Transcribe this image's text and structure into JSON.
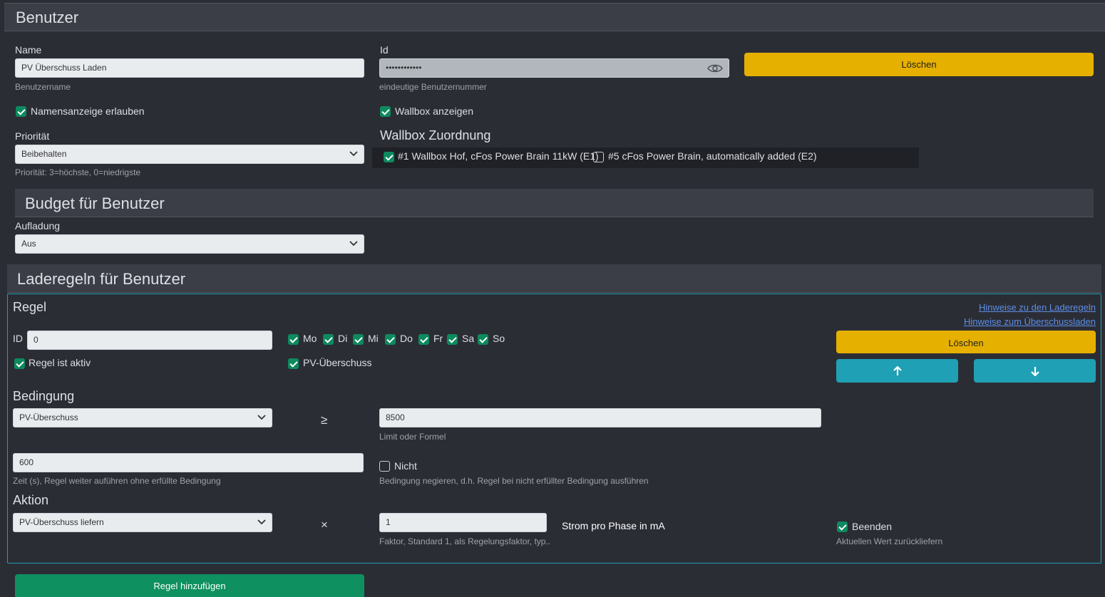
{
  "header": {
    "title": "Benutzer"
  },
  "user": {
    "name_label": "Name",
    "name_value": "PV Überschuss Laden",
    "name_hint": "Benutzername",
    "id_label": "Id",
    "id_value": "••••••••••••",
    "id_hint": "eindeutige Benutzernummer",
    "delete_label": "Löschen",
    "allow_name_label": "Namensanzeige erlauben",
    "show_wallbox_label": "Wallbox anzeigen",
    "priority_label": "Priorität",
    "priority_value": "Beibehalten",
    "priority_hint": "Priorität: 3=höchste, 0=niedrigste",
    "wallbox_assign_title": "Wallbox Zuordnung",
    "wallbox_1": "#1 Wallbox Hof, cFos Power Brain 11kW (E1)",
    "wallbox_2": "#5 cFos Power Brain, automatically added (E2)"
  },
  "budget": {
    "title": "Budget für Benutzer",
    "charging_label": "Aufladung",
    "charging_value": "Aus"
  },
  "rules": {
    "title": "Laderegeln für Benutzer",
    "rule_title": "Regel",
    "link_rules": "Hinweise zu den Laderegeln",
    "link_surplus": "Hinweise zum Überschussladen",
    "id_label": "ID",
    "id_value": "0",
    "days": [
      "Mo",
      "Di",
      "Mi",
      "Do",
      "Fr",
      "Sa",
      "So"
    ],
    "active_label": "Regel ist aktiv",
    "pv_label": "PV-Überschuss",
    "delete_label": "Löschen",
    "condition_title": "Bedingung",
    "condition_value": "PV-Überschuss",
    "condition_operator": "≥",
    "limit_value": "8500",
    "limit_hint": "Limit oder Formel",
    "time_value": "600",
    "time_hint": "Zeit (s), Regel weiter auführen ohne erfüllte Bedingung",
    "not_label": "Nicht",
    "not_hint": "Bedingung negieren, d.h. Regel bei nicht erfüllter Bedingung ausführen",
    "action_title": "Aktion",
    "action_value": "PV-Überschuss liefern",
    "action_operator": "×",
    "factor_value": "1",
    "factor_hint": "Faktor, Standard 1, als Regelungsfaktor, typ...",
    "unit_label": "Strom pro Phase in mA",
    "end_label": "Beenden",
    "end_hint": "Aktuellen Wert zurückliefern",
    "add_rule_label": "Regel hinzufügen"
  },
  "colors": {
    "accent_yellow": "#e6b000",
    "accent_cyan": "#1fa0b5",
    "accent_green": "#0e9060",
    "check_green": "#0d8a5e"
  }
}
